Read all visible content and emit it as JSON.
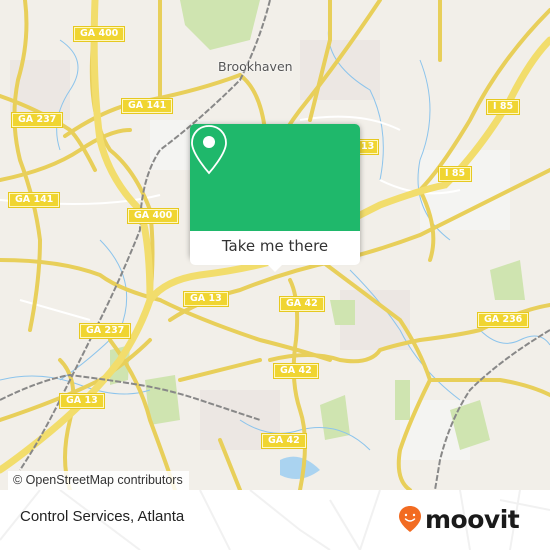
{
  "map": {
    "place_labels": [
      {
        "id": "brookhaven",
        "text": "Brookhaven"
      }
    ],
    "road_shields": [
      {
        "id": "ga400-top",
        "text": "GA 400"
      },
      {
        "id": "ga141-top",
        "text": "GA 141"
      },
      {
        "id": "ga237-left",
        "text": "GA 237"
      },
      {
        "id": "ga141-left",
        "text": "GA 141"
      },
      {
        "id": "ga400-mid",
        "text": "GA 400"
      },
      {
        "id": "ga13-top",
        "text": "13"
      },
      {
        "id": "i85-top",
        "text": "I 85"
      },
      {
        "id": "i85-mid",
        "text": "I 85"
      },
      {
        "id": "ga13-mid",
        "text": "GA 13"
      },
      {
        "id": "ga42-a",
        "text": "GA 42"
      },
      {
        "id": "ga237-mid",
        "text": "GA 237"
      },
      {
        "id": "ga236",
        "text": "GA 236"
      },
      {
        "id": "ga42-b",
        "text": "GA 42"
      },
      {
        "id": "ga13-low",
        "text": "GA 13"
      },
      {
        "id": "ga42-c",
        "text": "GA 42"
      }
    ],
    "attribution": "© OpenStreetMap contributors",
    "popup": {
      "icon": "location-pin-icon",
      "button_label": "Take me there",
      "accent_color": "#1fb86b"
    }
  },
  "footer": {
    "title": "Control Services, Atlanta",
    "logo_text": "moovit",
    "logo_color": "#f26b21"
  }
}
